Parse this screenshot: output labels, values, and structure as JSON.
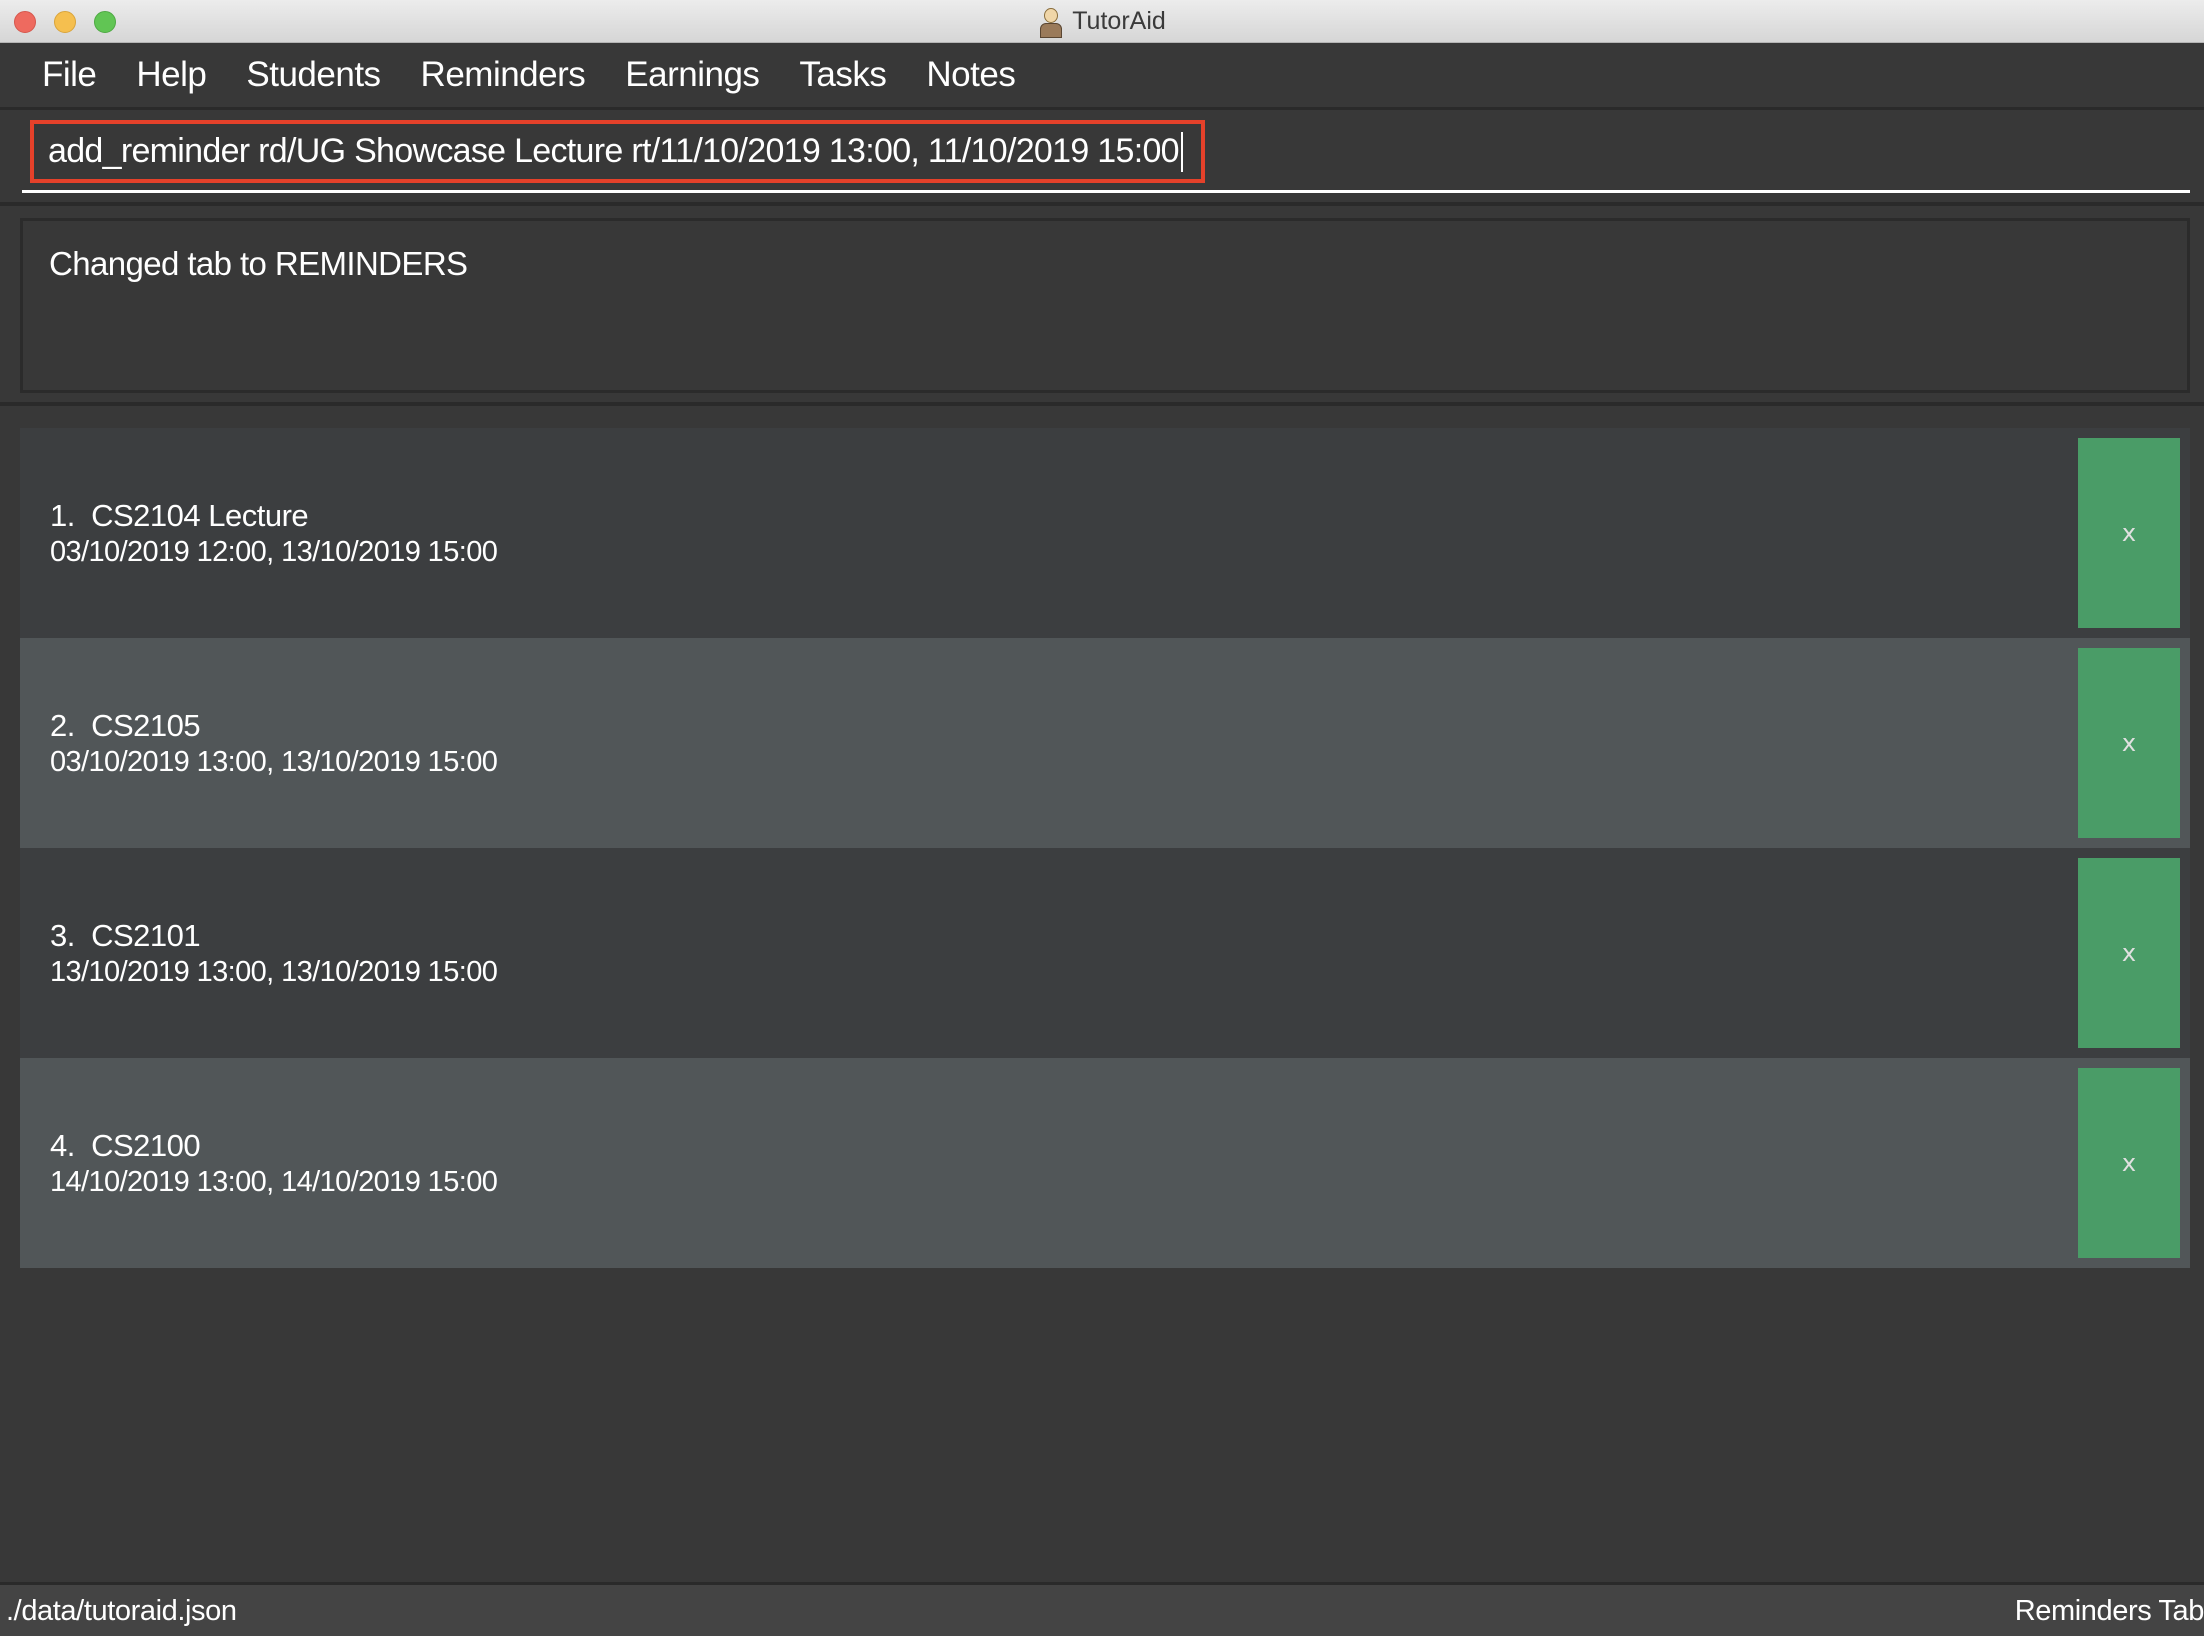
{
  "window": {
    "title": "TutorAid",
    "app_icon": "tutor-avatar-icon"
  },
  "menu": {
    "items": [
      {
        "label": "File"
      },
      {
        "label": "Help"
      },
      {
        "label": "Students"
      },
      {
        "label": "Reminders"
      },
      {
        "label": "Earnings"
      },
      {
        "label": "Tasks"
      },
      {
        "label": "Notes"
      }
    ]
  },
  "command": {
    "value": "add_reminder rd/UG Showcase Lecture rt/11/10/2019 13:00, 11/10/2019 15:00",
    "highlight_color": "#e5412a"
  },
  "result": {
    "message": "Changed tab to REMINDERS"
  },
  "reminders": {
    "items": [
      {
        "index": "1.",
        "description": "CS2104 Lecture",
        "time": "03/10/2019 12:00, 13/10/2019 15:00",
        "delete_label": "x"
      },
      {
        "index": "2.",
        "description": "CS2105",
        "time": "03/10/2019 13:00, 13/10/2019 15:00",
        "delete_label": "x"
      },
      {
        "index": "3.",
        "description": "CS2101",
        "time": "13/10/2019 13:00, 13/10/2019 15:00",
        "delete_label": "x"
      },
      {
        "index": "4.",
        "description": "CS2100",
        "time": "14/10/2019 13:00, 14/10/2019 15:00",
        "delete_label": "x"
      }
    ],
    "delete_button_color": "#4a9c67"
  },
  "statusbar": {
    "file_path": "./data/tutoraid.json",
    "current_tab": "Reminders Tab"
  }
}
